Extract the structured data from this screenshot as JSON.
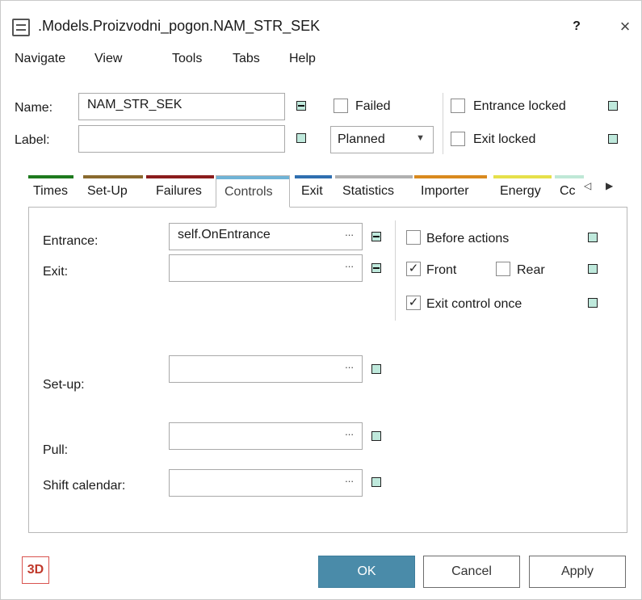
{
  "window": {
    "title": ".Models.Proizvodni_pogon.NAM_STR_SEK",
    "help_label": "?",
    "close_label": "×"
  },
  "menu": [
    "Navigate",
    "View",
    "Tools",
    "Tabs",
    "Help"
  ],
  "header": {
    "name_label": "Name:",
    "name_value": "NAM_STR_SEK",
    "label_label": "Label:",
    "label_value": "",
    "failed_label": "Failed",
    "failed_checked": false,
    "status_value": "Planned",
    "entrance_locked_label": "Entrance locked",
    "entrance_locked_checked": false,
    "exit_locked_label": "Exit locked",
    "exit_locked_checked": false
  },
  "tabs": [
    {
      "label": "Times",
      "color": "#1e7a1e"
    },
    {
      "label": "Set-Up",
      "color": "#8a6a2e"
    },
    {
      "label": "Failures",
      "color": "#8b1c1c"
    },
    {
      "label": "Controls",
      "color": "#6fb3d6",
      "active": true
    },
    {
      "label": "Exit",
      "color": "#2f6fb0"
    },
    {
      "label": "Statistics",
      "color": "#b0b0b0"
    },
    {
      "label": "Importer",
      "color": "#d98a1e"
    },
    {
      "label": "Energy",
      "color": "#e6e04a"
    },
    {
      "label": "Cc",
      "color": "#bfe8d6"
    }
  ],
  "tab_nav": {
    "prev": "◁",
    "next": "▶"
  },
  "controls": {
    "entrance_label": "Entrance:",
    "entrance_value": "self.OnEntrance",
    "exit_label": "Exit:",
    "exit_value": "",
    "setup_label": "Set-up:",
    "setup_value": "",
    "pull_label": "Pull:",
    "pull_value": "",
    "shift_calendar_label": "Shift calendar:",
    "shift_calendar_value": "",
    "ellipsis": "...",
    "before_actions_label": "Before actions",
    "before_actions_checked": false,
    "front_label": "Front",
    "front_checked": true,
    "rear_label": "Rear",
    "rear_checked": false,
    "exit_control_once_label": "Exit control once",
    "exit_control_once_checked": true
  },
  "footer": {
    "three_d_label": "3D",
    "ok_label": "OK",
    "cancel_label": "Cancel",
    "apply_label": "Apply"
  },
  "colors": {
    "accent_button": "#4a8ba9",
    "indicator_fill": "#bfe9dc",
    "three_d_red": "#c0392b"
  }
}
